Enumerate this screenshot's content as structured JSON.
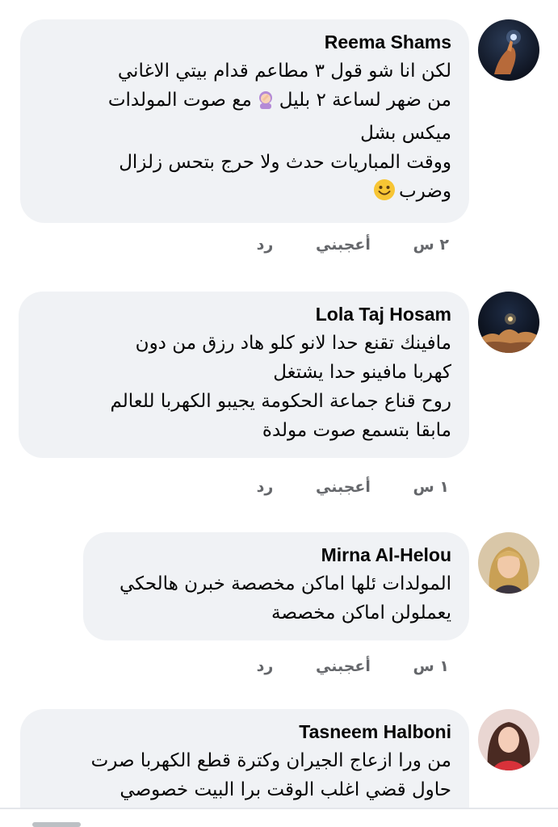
{
  "comments": [
    {
      "author": "Reema Shams",
      "lines": [
        "لكن انا شو قول ٣ مطاعم قدام بيتي الاغاني",
        "من ضهر لساعة ٢ بليل",
        "مع صوت المولدات",
        "ميكس بشل",
        "ووقت المباريات حدث ولا حرج بتحس زلزال",
        "وضرب"
      ],
      "emoji_facepalm": "facepalm-emoji",
      "emoji_smile": "smile-emoji",
      "time": "٢ س",
      "like_label": "أعجبني",
      "reply_label": "رد"
    },
    {
      "author": "Lola Taj Hosam",
      "lines": [
        "مافينك تقنع حدا لانو كلو هاد رزق من دون",
        "كهربا مافينو حدا يشتغل",
        "روح قناع جماعة الحكومة يجيبو الكهربا للعالم",
        "مابقا بتسمع صوت مولدة"
      ],
      "time": "١ س",
      "like_label": "أعجبني",
      "reply_label": "رد"
    },
    {
      "author": "Mirna Al-Helou",
      "lines": [
        "المولدات ئلها اماكن مخصصة خبرن هالحكي",
        "يعملولن اماكن مخصصة"
      ],
      "time": "١ س",
      "like_label": "أعجبني",
      "reply_label": "رد"
    },
    {
      "author": "Tasneem Halboni",
      "lines": [
        "من ورا ازعاج الجيران وكترة قطع الكهربا صرت",
        "حاول قضي اغلب الوقت برا البيت خصوصي"
      ]
    }
  ],
  "colors": {
    "bubble": "#f0f2f5",
    "text": "#050505",
    "meta": "#65676b"
  }
}
